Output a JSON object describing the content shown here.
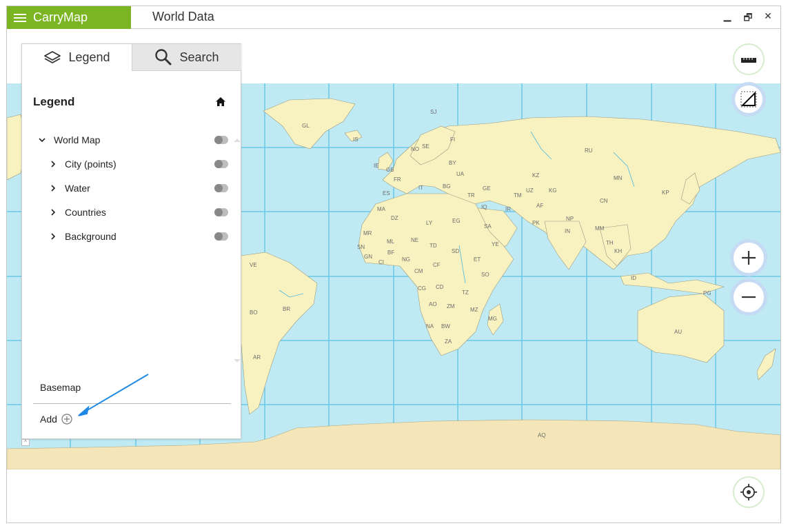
{
  "app": {
    "name": "CarryMap",
    "document_title": "World Data"
  },
  "window_controls": {
    "minimize": "▁",
    "restore": "🗗",
    "close": "✕"
  },
  "panel": {
    "tabs": [
      {
        "label": "Legend",
        "icon": "layers-icon",
        "active": true
      },
      {
        "label": "Search",
        "icon": "search-icon",
        "active": false
      }
    ],
    "title": "Legend",
    "layers": [
      {
        "label": "World Map",
        "expanded": true,
        "visible": true
      },
      {
        "label": "City (points)",
        "expanded": false,
        "visible": true
      },
      {
        "label": "Water",
        "expanded": false,
        "visible": true
      },
      {
        "label": "Countries",
        "expanded": false,
        "visible": true
      },
      {
        "label": "Background",
        "expanded": false,
        "visible": true
      }
    ],
    "basemap_label": "Basemap",
    "add_label": "Add"
  },
  "map": {
    "country_labels": [
      "GL",
      "IS",
      "SJ",
      "FI",
      "NO",
      "SE",
      "IE",
      "GB",
      "BY",
      "UA",
      "FR",
      "IT",
      "BG",
      "ES",
      "TR",
      "GE",
      "KZ",
      "RU",
      "MN",
      "KP",
      "CN",
      "UZ",
      "TM",
      "KG",
      "IQ",
      "IR",
      "AF",
      "PK",
      "NP",
      "IN",
      "MM",
      "TH",
      "KH",
      "SA",
      "YE",
      "EG",
      "LY",
      "DZ",
      "MA",
      "MR",
      "ML",
      "NE",
      "TD",
      "SD",
      "ET",
      "SN",
      "GN",
      "BF",
      "CI",
      "NG",
      "CM",
      "CF",
      "CG",
      "CD",
      "TZ",
      "AO",
      "ZM",
      "MZ",
      "MG",
      "NA",
      "BW",
      "ZA",
      "SO",
      "VE",
      "BR",
      "BO",
      "AR",
      "ID",
      "PG",
      "AU",
      "AQ"
    ],
    "colors": {
      "ocean": "#bfeaf4",
      "land": "#f8f1c0",
      "land_alt": "#f1e2b0",
      "graticule": "#6cc8e6",
      "ice": "#f4e6b8"
    }
  },
  "controls": {
    "ruler": "ruler-icon",
    "measure": "measure-area-icon",
    "zoom_in": "plus-icon",
    "zoom_out": "minus-icon",
    "locate": "locate-icon"
  }
}
